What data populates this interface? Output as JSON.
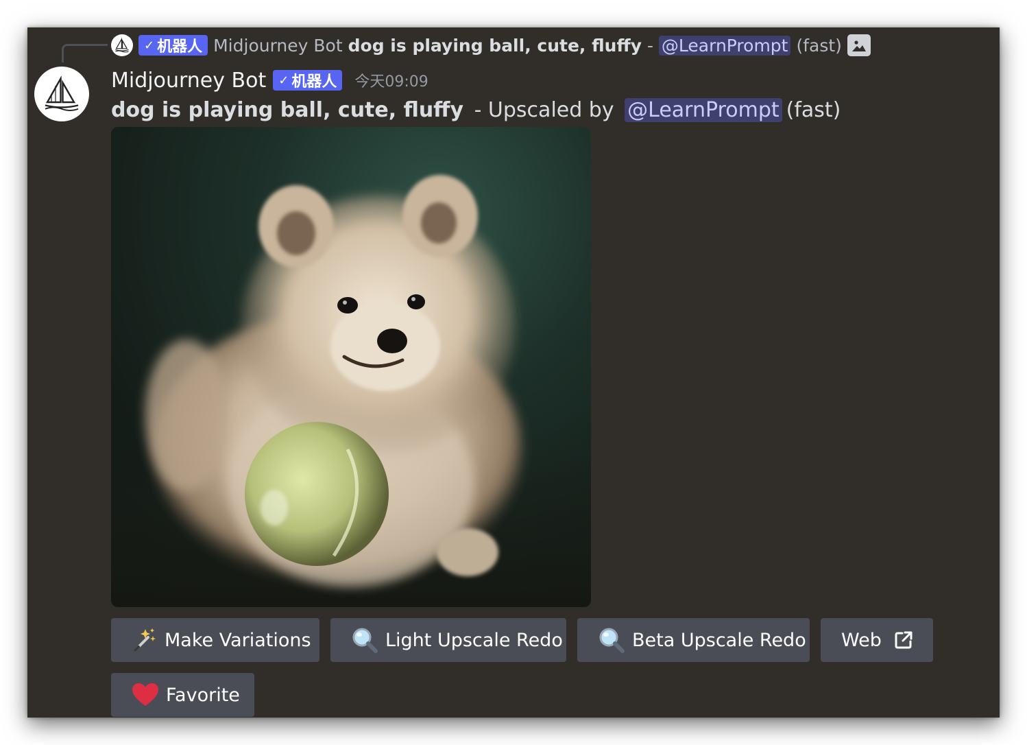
{
  "reply": {
    "badge_check": "✓",
    "badge_label": "机器人",
    "author": "Midjourney Bot",
    "prompt": "dog is playing ball, cute, fluffy",
    "separator": " - ",
    "mention": "@LearnPrompt",
    "speed": "(fast)",
    "attachment_icon": "image-icon"
  },
  "message": {
    "username": "Midjourney Bot",
    "badge_check": "✓",
    "badge_label": "机器人",
    "timestamp": "今天09:09",
    "prompt": "dog is playing ball, cute, fluffy",
    "upscaled_by": " - Upscaled by ",
    "mention": "@LearnPrompt",
    "speed": "(fast)",
    "avatar_icon": "sailboat-icon"
  },
  "buttons": {
    "make_variations": {
      "label": "Make Variations",
      "icon": "magic-wand-icon"
    },
    "light_upscale_redo": {
      "label": "Light Upscale Redo",
      "icon": "magnifier-icon"
    },
    "beta_upscale_redo": {
      "label": "Beta Upscale Redo",
      "icon": "magnifier-icon"
    },
    "web": {
      "label": "Web",
      "icon": "external-link-icon"
    },
    "favorite": {
      "label": "Favorite",
      "icon": "heart-icon"
    }
  },
  "colors": {
    "background": "#312d29",
    "badge": "#5865f2",
    "mention_bg": "#3c4270",
    "button": "#4a4d55",
    "heart": "#dd2e44"
  }
}
